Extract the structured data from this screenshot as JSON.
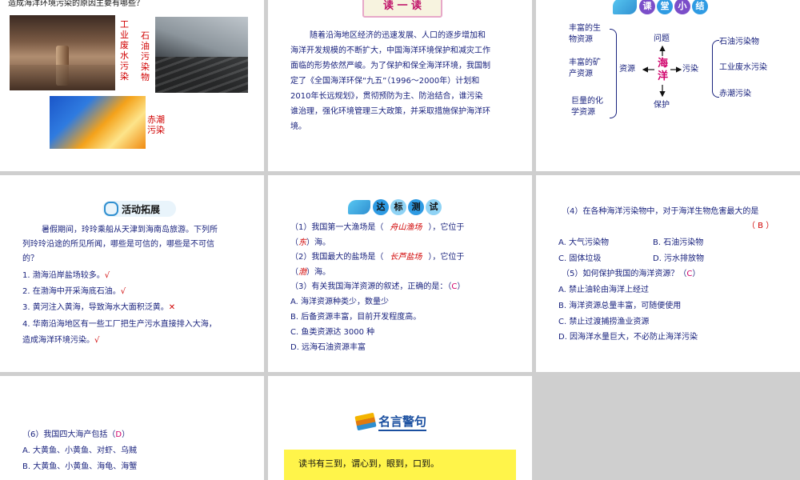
{
  "s1": {
    "question": "造成海洋环境污染的原因主要有哪些？",
    "label_industrial": [
      "工",
      "业",
      "废",
      "水",
      "污",
      "染"
    ],
    "label_oil": [
      "石",
      "油",
      "污",
      "染",
      "物"
    ],
    "label_redtide": [
      "赤潮",
      "污染"
    ]
  },
  "s2": {
    "title": "读 一 读",
    "lines": [
      "随着沿海地区经济的迅速发展、人口的逐步增加和",
      "海洋开发规模的不断扩大，中国海洋环境保护和减灾工作",
      "面临的形势依然严峻。为了保护和保全海洋环境，我国制",
      "定了《全国海洋环保“九五”（1996～2000年）计划和",
      "2010年长远规划》，贯彻预防为主、防治结合，谁污染",
      "谁治理，强化环境管理三大政策，并采取措施保护海洋环",
      "境。"
    ]
  },
  "s3": {
    "title": [
      "课",
      "堂",
      "小",
      "结"
    ],
    "left": [
      [
        "丰富的生",
        "物资源"
      ],
      [
        "丰富的矿",
        "产资源"
      ],
      [
        "巨量的化",
        "学资源"
      ]
    ],
    "ziyuan": "资源",
    "wenti": "问题",
    "haiyang": [
      "海",
      "洋"
    ],
    "wuran": "污染",
    "baohu": "保护",
    "right": [
      "石油污染物",
      "工业废水污染",
      "赤潮污染"
    ]
  },
  "s4": {
    "title": "活动拓展",
    "intro": [
      "暑假期间，玲玲乘船从天津到海南岛旅游。下列所",
      "列玲玲沿途的所见所闻，哪些是可信的，哪些是不可信",
      "的？"
    ],
    "items": [
      {
        "text": "1. 渤海沿岸盐场较多。",
        "mark": "√"
      },
      {
        "text": "2. 在渤海中开采海底石油。",
        "mark": "√"
      },
      {
        "text": "3. 黄河注入黄海，导致海水大面积泛黄。",
        "mark": "✕"
      },
      {
        "text": "4. 华南沿海地区有一些工厂把生产污水直接排入大海，",
        "mark": ""
      },
      {
        "text": "造成海洋环境污染。",
        "mark": "√"
      }
    ]
  },
  "s5": {
    "title": [
      "达",
      "标",
      "测",
      "试"
    ],
    "q1a": "（1）我国第一大渔场是（",
    "q1ans": "舟山渔场",
    "q1b": "），它位于",
    "q1c": "（",
    "q1ans2": "东",
    "q1d": "）海。",
    "q2a": "（2）我国最大的盐场是（",
    "q2ans": "长芦盐场",
    "q2b": "），它位于",
    "q2c": "（",
    "q2ans2": "渤",
    "q2d": "）海。",
    "q3": "（3）有关我国海洋资源的叙述，正确的是：（",
    "q3ans": "C",
    "q3end": "）",
    "opts": [
      "A. 海洋资源种类少，数量少",
      "B. 后备资源丰富，目前开发程度高。",
      "C. 鱼类资源达 3000 种",
      "D. 远海石油资源丰富"
    ]
  },
  "s6": {
    "q4": "（4）在各种海洋污染物中，对于海洋生物危害最大的是",
    "q4ans": "（ B ）",
    "q4opts": [
      "A. 大气污染物",
      "B. 石油污染物",
      "C. 固体垃圾",
      "D. 污水排放物"
    ],
    "q5": "（5）如何保护我国的海洋资源？（",
    "q5ans": "C",
    "q5end": "）",
    "q5opts": [
      "A. 禁止油轮由海洋上经过",
      "B. 海洋资源总量丰富，可随便使用",
      "C. 禁止过渡捕捞渔业资源",
      "D. 因海洋水量巨大，不必防止海洋污染"
    ]
  },
  "s7": {
    "q6": "（6）我国四大海产包括（",
    "q6ans": "D",
    "q6end": "）",
    "opts": [
      "A. 大黄鱼、小黄鱼、对虾、乌贼",
      "B. 大黄鱼、小黄鱼、海龟、海蟹"
    ]
  },
  "s8": {
    "title": "名言警句",
    "quote": "读书有三到，谓心到，眼到，口到。"
  },
  "colors": {
    "navy": "#1a237e",
    "red": "#d00000",
    "quote_bg": "#fff44a"
  }
}
